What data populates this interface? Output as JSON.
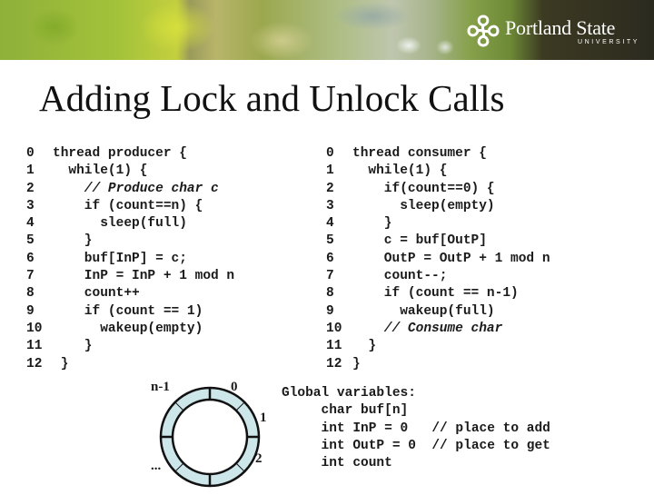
{
  "header": {
    "logo": {
      "icon": "psu-knot-logo-icon",
      "name": "Portland State",
      "subname": "UNIVERSITY"
    }
  },
  "slide": {
    "title": "Adding Lock and Unlock Calls"
  },
  "producer": {
    "lines": [
      {
        "num": "0",
        "text": "thread producer {"
      },
      {
        "num": "1",
        "text": "  while(1) {"
      },
      {
        "num": "2",
        "text": "    // Produce char c",
        "comment": true
      },
      {
        "num": "3",
        "text": "    if (count==n) {"
      },
      {
        "num": "4",
        "text": "      sleep(full)"
      },
      {
        "num": "5",
        "text": "    }"
      },
      {
        "num": "6",
        "text": "    buf[InP] = c;"
      },
      {
        "num": "7",
        "text": "    InP = InP + 1 mod n"
      },
      {
        "num": "8",
        "text": "    count++"
      },
      {
        "num": "9",
        "text": "    if (count == 1)"
      },
      {
        "num": "10",
        "text": "      wakeup(empty)"
      },
      {
        "num": "11",
        "text": "    }"
      },
      {
        "num": "12",
        "text": " }"
      }
    ]
  },
  "consumer": {
    "lines": [
      {
        "num": "0",
        "text": "thread consumer {"
      },
      {
        "num": "1",
        "text": "  while(1) {"
      },
      {
        "num": "2",
        "text": "    if(count==0) {"
      },
      {
        "num": "3",
        "text": "      sleep(empty)"
      },
      {
        "num": "4",
        "text": "    }"
      },
      {
        "num": "5",
        "text": "    c = buf[OutP]"
      },
      {
        "num": "6",
        "text": "    OutP = OutP + 1 mod n"
      },
      {
        "num": "7",
        "text": "    count--;"
      },
      {
        "num": "8",
        "text": "    if (count == n-1)"
      },
      {
        "num": "9",
        "text": "      wakeup(full)"
      },
      {
        "num": "10",
        "text": "    // Consume char",
        "comment": true
      },
      {
        "num": "11",
        "text": "  }"
      },
      {
        "num": "12",
        "text": "}"
      }
    ]
  },
  "ring_buffer": {
    "fill_color": "#cce6ea",
    "stroke_color": "#111111",
    "labels": {
      "n_minus_1": "n-1",
      "zero": "0",
      "one": "1",
      "two": "2",
      "ellipsis": "..."
    }
  },
  "globals": {
    "lines": [
      "Global variables:",
      "     char buf[n]",
      "     int InP = 0   // place to add",
      "     int OutP = 0  // place to get",
      "     int count"
    ]
  }
}
